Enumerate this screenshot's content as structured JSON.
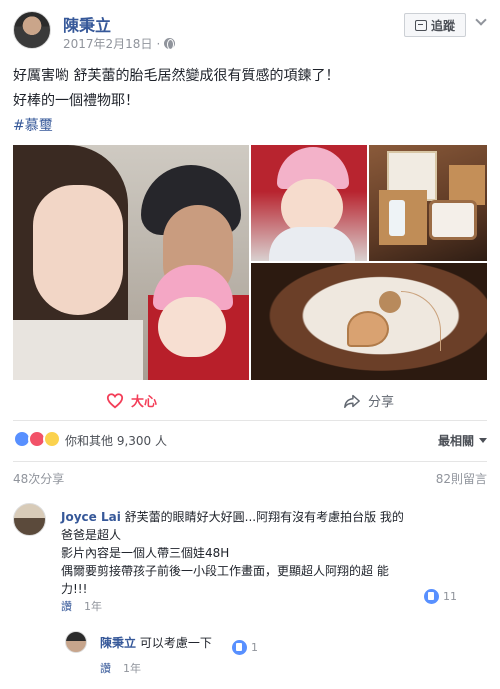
{
  "post": {
    "author": "陳秉立",
    "date": "2017年2月18日",
    "date_suffix": "·",
    "follow_label": "追蹤",
    "text_lines": [
      "好厲害喲 舒芙蕾的胎毛居然變成很有質感的項鍊了！",
      "好棒的一個禮物耶！"
    ],
    "hashtag": "#慕璽"
  },
  "actions": {
    "love_label": "大心",
    "share_label": "分享"
  },
  "reactions": {
    "summary": "你和其他 9,300 人",
    "sort_label": "最相關",
    "icons": [
      "like-icon",
      "love-icon",
      "wow-icon"
    ]
  },
  "stats": {
    "shares": "48次分享",
    "comments": "82則留言"
  },
  "comments": [
    {
      "author": "Joyce Lai",
      "lines": [
        " 舒芙蕾的眼睛好大好圓...阿翔有沒有考慮拍台版 我的",
        "爸爸是超人",
        "影片內容是一個人帶三個娃48H",
        "偶爾要剪接帶孩子前後一小段工作畫面，更顯超人阿翔的超 能",
        "力!!!"
      ],
      "like_label": "讚",
      "time": "1年",
      "likes": "11"
    },
    {
      "author": "陳秉立",
      "text": " 可以考慮一下",
      "like_label": "讚",
      "time": "1年",
      "likes": "1"
    }
  ],
  "colors": {
    "link": "#365899",
    "love": "#f33e58",
    "like": "#5890ff",
    "muted": "#90949c"
  }
}
